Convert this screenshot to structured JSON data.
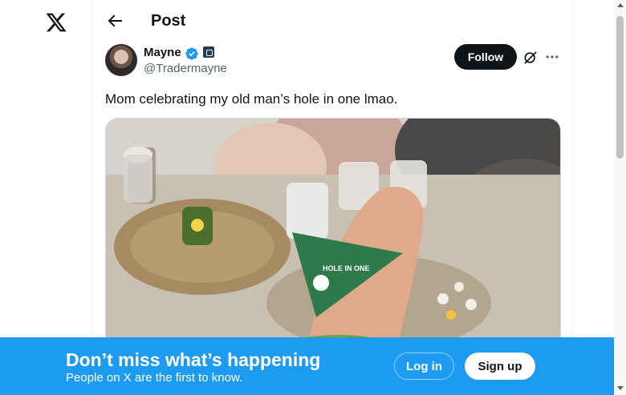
{
  "header": {
    "title": "Post"
  },
  "tweet": {
    "author_name": "Mayne",
    "author_handle": "@Tradermayne",
    "text": "Mom celebrating my old man’s hole in one lmao.",
    "follow_label": "Follow",
    "media_flag_text": "HOLE IN ONE"
  },
  "banner": {
    "title": "Don’t miss what’s happening",
    "subtitle": "People on X are the first to know.",
    "login_label": "Log in",
    "signup_label": "Sign up"
  },
  "colors": {
    "accent": "#1d9bf0",
    "text": "#0f1419",
    "muted": "#536471",
    "follow_bg": "#0f1419"
  },
  "icons": [
    "x-logo-icon",
    "back-arrow-icon",
    "verified-badge-icon",
    "affiliate-badge-icon",
    "grok-icon",
    "more-icon"
  ]
}
